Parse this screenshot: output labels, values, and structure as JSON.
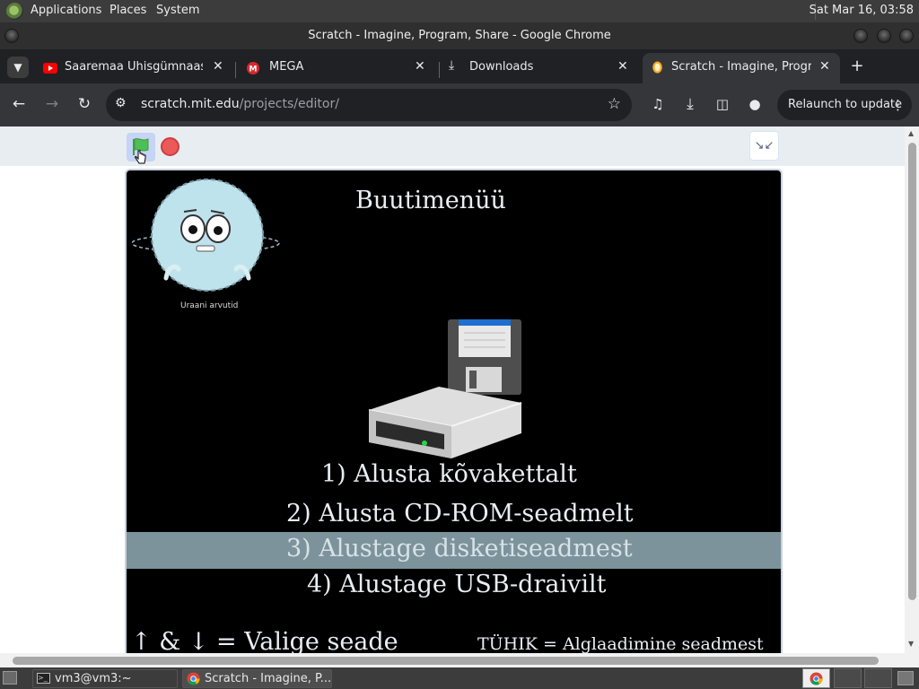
{
  "panel": {
    "menus": [
      "Applications",
      "Places",
      "System"
    ],
    "clock": "Sat Mar 16, 03:58"
  },
  "window": {
    "title": "Scratch - Imagine, Program, Share - Google Chrome"
  },
  "tabs": [
    {
      "title": "Saaremaa Ühisgümnaasium",
      "favicon": "youtube-icon",
      "active": false
    },
    {
      "title": "MEGA",
      "favicon": "mega-icon",
      "active": false
    },
    {
      "title": "Downloads",
      "favicon": "download-icon",
      "active": false
    },
    {
      "title": "Scratch - Imagine, Program",
      "favicon": "scratch-icon",
      "active": true
    }
  ],
  "toolbar": {
    "url_host": "scratch.mit.edu",
    "url_path": "/projects/editor/",
    "relaunch_label": "Relaunch to update"
  },
  "stage": {
    "character_caption": "Uraani arvutid",
    "heading": "Buutimenüü",
    "options": [
      "1) Alusta kõvakettalt",
      "2) Alusta CD-ROM-seadmelt",
      "3) Alustage disketiseadmest",
      "4) Alustage USB-draivilt"
    ],
    "selected_option_index": 2,
    "footer_left": "↑ & ↓ = Valige seade",
    "footer_right": "TÜHIK = Alglaadimine seadmest"
  },
  "taskbar": {
    "items": [
      "vm3@vm3:~",
      "Scratch - Imagine, P..."
    ]
  },
  "colors": {
    "stage_background": "#000000",
    "highlight": "#7d939c",
    "stage_text": "#e9eef2"
  }
}
